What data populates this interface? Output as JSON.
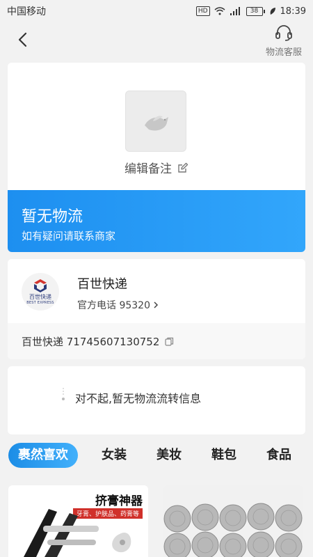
{
  "status_bar": {
    "carrier": "中国移动",
    "hd": "HD",
    "battery": "38",
    "time": "18:39"
  },
  "nav": {
    "service_label": "物流客服"
  },
  "note_card": {
    "edit_note_label": "编辑备注"
  },
  "status_banner": {
    "title": "暂无物流",
    "subtitle": "如有疑问请联系商家"
  },
  "courier": {
    "logo_text_cn": "百世快递",
    "logo_text_en": "BEST EXPRESS",
    "name": "百世快递",
    "phone_label": "官方电话 95320",
    "tracking": "百世快递 71745607130752"
  },
  "empty_tracking": {
    "message": "对不起,暂无物流流转信息"
  },
  "tabs": [
    {
      "label": "裹然喜欢",
      "active": true
    },
    {
      "label": "女装",
      "active": false
    },
    {
      "label": "美妆",
      "active": false
    },
    {
      "label": "鞋包",
      "active": false
    },
    {
      "label": "食品",
      "active": false
    }
  ],
  "products": [
    {
      "promo_title": "挤膏神器",
      "promo_sub": "牙膏、护肤品、药膏等"
    },
    {
      "promo_title": "",
      "promo_sub": ""
    }
  ],
  "colors": {
    "accent": "#1d8ff0",
    "promo_red": "#d0302a",
    "bg": "#f2f2f2"
  }
}
